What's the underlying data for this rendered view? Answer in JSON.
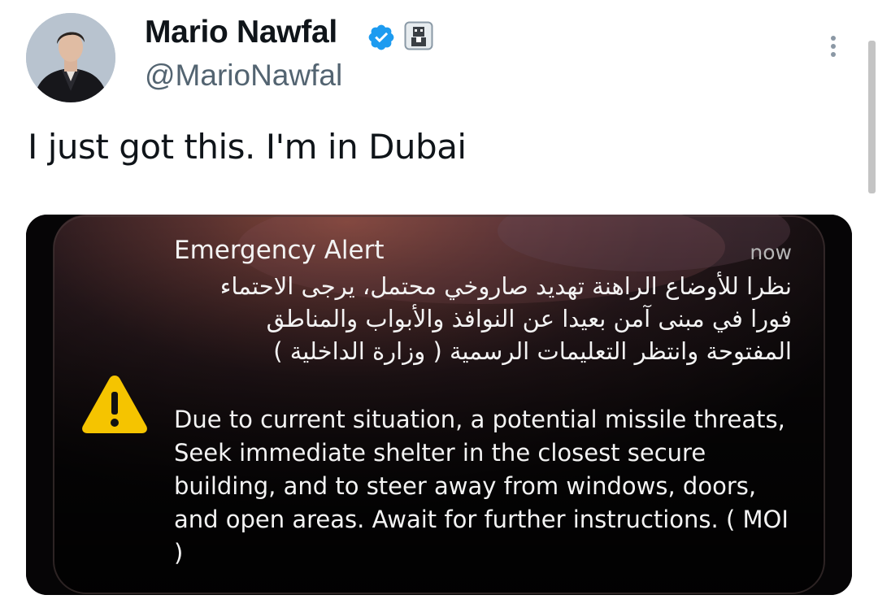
{
  "author": {
    "display_name": "Mario Nawfal",
    "handle": "@MarioNawfal",
    "verified_icon": "verified-badge-icon",
    "affiliate_icon": "affiliate-badge-icon",
    "avatar": "avatar"
  },
  "header": {
    "more_icon": "more-vertical-icon"
  },
  "tweet": {
    "text": "I just got this. I'm in Dubai"
  },
  "media": {
    "alert_title": "Emergency Alert",
    "alert_time": "now",
    "alert_arabic": "نظرا للأوضاع الراهنة تهديد صاروخي محتمل، يرجى الاحتماء فورا في مبنى آمن بعيدا عن النوافذ والأبواب والمناطق المفتوحة وانتظر التعليمات الرسمية ( وزارة الداخلية )",
    "alert_english": "Due to current situation, a potential missile threats, Seek immediate shelter in the closest secure building, and to steer away from windows, doors, and open areas. Await for further instructions. ( MOI  )",
    "warning_icon": "warning-triangle-icon"
  },
  "colors": {
    "text_primary": "#0f1419",
    "text_secondary": "#536471",
    "verified": "#1d9bf0",
    "alert_yellow": "#f5c400"
  }
}
